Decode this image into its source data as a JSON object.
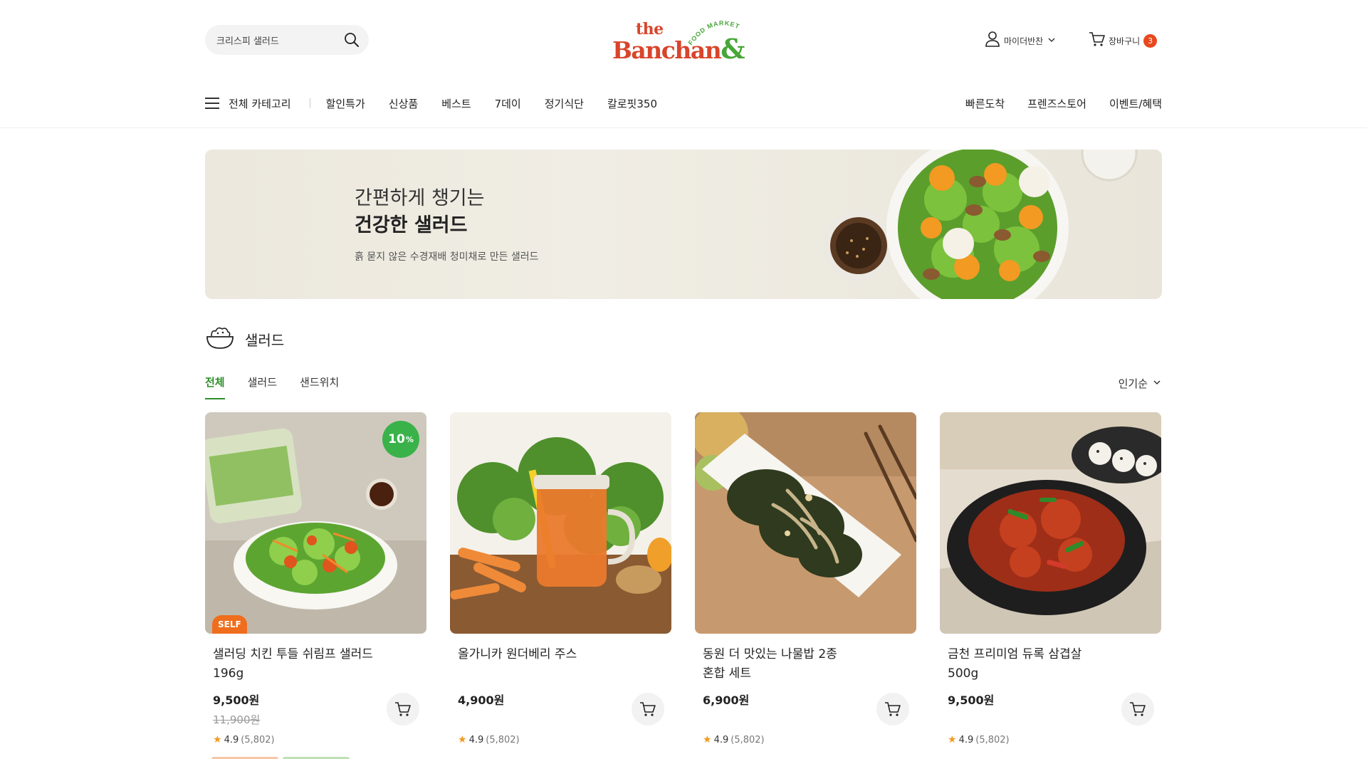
{
  "header": {
    "search_placeholder": "크리스피 샐러드",
    "logo": {
      "the": "the",
      "main": "Banchan",
      "amp": "&",
      "tagline": "FOOD MARKET"
    },
    "user_menu": "마이더반찬",
    "cart_label": "장바구니",
    "cart_count": "3"
  },
  "nav": {
    "all_categories": "전체 카테고리",
    "items": [
      "할인특가",
      "신상품",
      "베스트",
      "7데이",
      "정기식단",
      "칼로핏350"
    ],
    "right_items": [
      "빠른도착",
      "프렌즈스토어",
      "이벤트/혜택"
    ]
  },
  "banner": {
    "line1": "간편하게 챙기는",
    "line2": "건강한 샐러드",
    "description": "흙 묻지 않은 수경재배 청미채로 만든 샐러드"
  },
  "category": {
    "title": "샐러드",
    "tabs": [
      "전체",
      "샐러드",
      "샌드위치"
    ],
    "active_tab": "전체",
    "sort": "인기순"
  },
  "products": [
    {
      "name_line1": "샐러딩 치킨 투들 쉬림프 샐러드",
      "name_line2": "196g",
      "price": "9,500원",
      "original_price": "11,900원",
      "discount": "10",
      "discount_unit": "%",
      "badge": "SELF",
      "rating": "4.9",
      "reviews": "(5,802)"
    },
    {
      "name_line1": "올가니카 원더베리 주스",
      "name_line2": "",
      "price": "4,900원",
      "rating": "4.9",
      "reviews": "(5,802)"
    },
    {
      "name_line1": "동원 더 맛있는 나물밥 2종",
      "name_line2": "혼합 세트",
      "price": "6,900원",
      "rating": "4.9",
      "reviews": "(5,802)"
    },
    {
      "name_line1": "금천 프리미엄 듀록 삼겹살",
      "name_line2": "500g",
      "price": "9,500원",
      "rating": "4.9",
      "reviews": "(5,802)"
    }
  ],
  "colors": {
    "brand_red": "#d8452b",
    "brand_green": "#47a637",
    "active_tab": "#2f8f2a",
    "discount_badge": "#3ab24a",
    "self_badge": "#ef6d1c",
    "cart_badge": "#e8481e",
    "star": "#f29a1f"
  },
  "icons": {
    "search": "search-icon",
    "user": "user-icon",
    "cart": "cart-icon",
    "menu": "hamburger-icon",
    "category": "salad-bowl-icon",
    "chevron": "chevron-down-icon",
    "star": "star-icon"
  }
}
